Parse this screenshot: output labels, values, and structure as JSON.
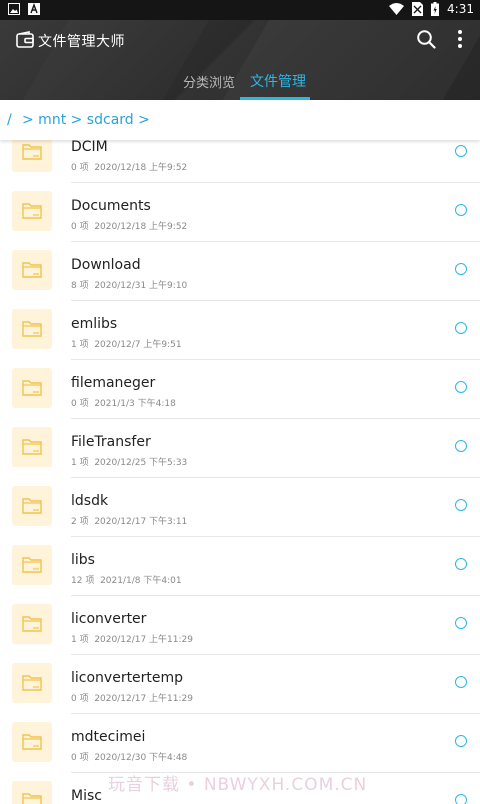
{
  "statusbar": {
    "time": "4:31"
  },
  "appbar": {
    "title": "文件管理大师",
    "tabs": [
      {
        "label": "分类浏览",
        "active": false
      },
      {
        "label": "文件管理",
        "active": true
      }
    ]
  },
  "breadcrumb": {
    "root": "/",
    "path": "> mnt > sdcard >"
  },
  "files": [
    {
      "name": "DCIM",
      "count": "0 项",
      "date": "2020/12/18 上午9:52"
    },
    {
      "name": "Documents",
      "count": "0 项",
      "date": "2020/12/18 上午9:52"
    },
    {
      "name": "Download",
      "count": "8 项",
      "date": "2020/12/31 上午9:10"
    },
    {
      "name": "emlibs",
      "count": "1 项",
      "date": "2020/12/7 上午9:51"
    },
    {
      "name": "filemaneger",
      "count": "0 项",
      "date": "2021/1/3 下午4:18"
    },
    {
      "name": "FileTransfer",
      "count": "1 项",
      "date": "2020/12/25 下午5:33"
    },
    {
      "name": "ldsdk",
      "count": "2 项",
      "date": "2020/12/17 下午3:11"
    },
    {
      "name": "libs",
      "count": "12 项",
      "date": "2021/1/8 下午4:01"
    },
    {
      "name": "liconverter",
      "count": "1 项",
      "date": "2020/12/17 上午11:29"
    },
    {
      "name": "liconvertertemp",
      "count": "0 项",
      "date": "2020/12/17 上午11:29"
    },
    {
      "name": "mdtecimei",
      "count": "0 项",
      "date": "2020/12/30 下午4:48"
    },
    {
      "name": "Misc",
      "count": "",
      "date": ""
    }
  ],
  "watermark": "玩音下载 • NBWYXH.COM.CN",
  "colors": {
    "accent": "#2bb7e6",
    "folder": "#f0c450",
    "folder_bg": "#fff4d9"
  }
}
